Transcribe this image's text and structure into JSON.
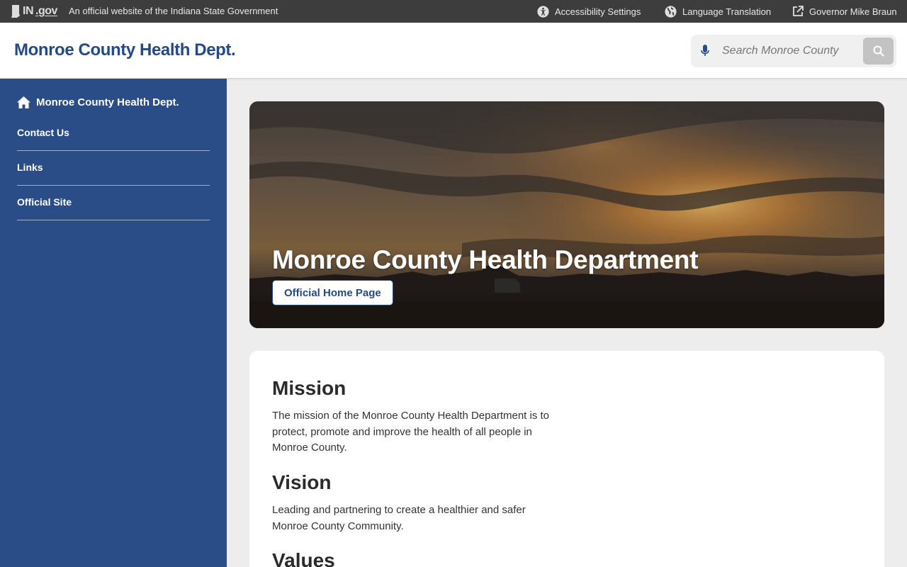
{
  "statebar": {
    "logo_in": "IN",
    "logo_gov": ".gov",
    "official_text": "An official website of the Indiana State Government",
    "accessibility_label": "Accessibility Settings",
    "language_label": "Language Translation",
    "governor_label": "Governor Mike Braun"
  },
  "header": {
    "site_title": "Monroe County Health Dept.",
    "search_placeholder": "Search Monroe County"
  },
  "sidebar": {
    "home_label": "Monroe County Health Dept.",
    "items": [
      {
        "label": "Contact Us"
      },
      {
        "label": "Links"
      },
      {
        "label": "Official Site"
      }
    ]
  },
  "hero": {
    "title": "Monroe County Health Department",
    "button_label": "Official Home Page"
  },
  "content": {
    "mission_heading": "Mission",
    "mission_text": "The mission of the Monroe County Health Department is to protect, promote and improve the health of all people in Monroe County.",
    "vision_heading": "Vision",
    "vision_text": "Leading and partnering to create a healthier and safer Monroe County Community.",
    "values_heading": "Values"
  },
  "colors": {
    "brand_blue": "#2a4c87",
    "title_blue": "#234a84",
    "statebar_bg": "#3d3d3d",
    "page_bg": "#ededed"
  },
  "icons": {
    "accessibility": "accessibility-icon",
    "language": "globe-icon",
    "governor": "external-link-icon",
    "mic": "microphone-icon",
    "search": "search-icon",
    "home": "home-icon"
  }
}
